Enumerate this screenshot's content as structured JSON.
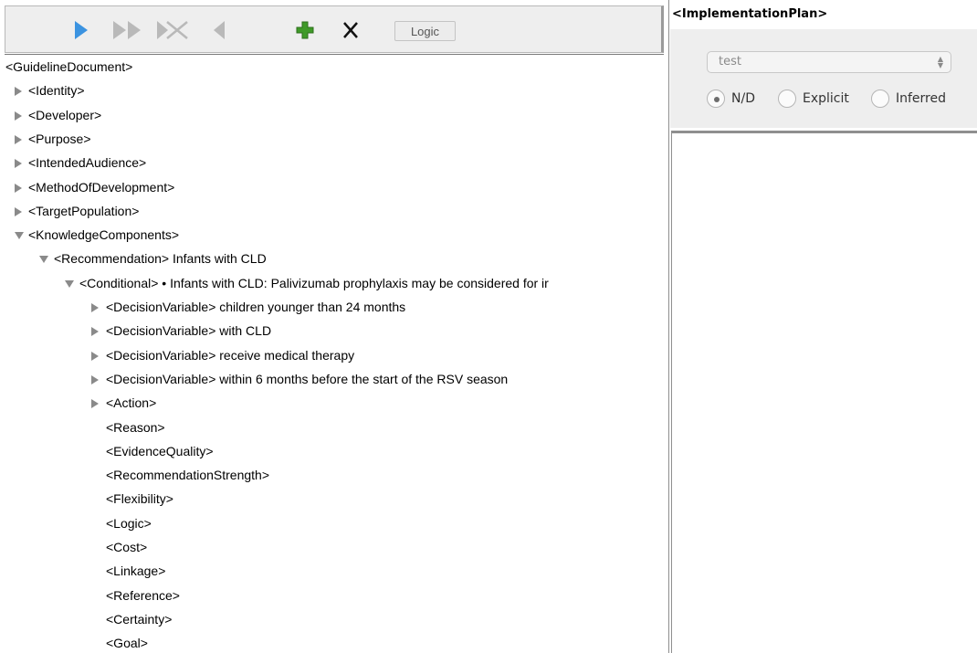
{
  "toolbar": {
    "buttons": [
      {
        "name": "play-icon",
        "color": "#3b93e0"
      },
      {
        "name": "fast-forward-icon",
        "color": "#b9b9b9"
      },
      {
        "name": "skip-clear-icon",
        "color": "#b9b9b9"
      },
      {
        "name": "back-icon",
        "color": "#b9b9b9"
      },
      {
        "name": "add-icon",
        "color": "#3f9a28"
      },
      {
        "name": "delete-icon",
        "color": "#111111"
      }
    ],
    "logic_label": "Logic"
  },
  "tree": [
    {
      "text": "<GuidelineDocument>",
      "depth": 0,
      "arrow": "none"
    },
    {
      "text": "<Identity>",
      "depth": 1,
      "arrow": "collapsed"
    },
    {
      "text": "<Developer>",
      "depth": 1,
      "arrow": "collapsed"
    },
    {
      "text": "<Purpose>",
      "depth": 1,
      "arrow": "collapsed"
    },
    {
      "text": "<IntendedAudience>",
      "depth": 1,
      "arrow": "collapsed"
    },
    {
      "text": "<MethodOfDevelopment>",
      "depth": 1,
      "arrow": "collapsed"
    },
    {
      "text": "<TargetPopulation>",
      "depth": 1,
      "arrow": "collapsed"
    },
    {
      "text": "<KnowledgeComponents>",
      "depth": 1,
      "arrow": "expanded"
    },
    {
      "text": "<Recommendation> Infants with CLD",
      "depth": 2,
      "arrow": "expanded"
    },
    {
      "text": "<Conditional> • Infants with CLD: Palivizumab prophylaxis may be considered for ir",
      "depth": 3,
      "arrow": "expanded"
    },
    {
      "text": "<DecisionVariable> children younger than 24 months",
      "depth": 4,
      "arrow": "collapsed"
    },
    {
      "text": "<DecisionVariable> with CLD",
      "depth": 4,
      "arrow": "collapsed"
    },
    {
      "text": "<DecisionVariable> receive medical therapy",
      "depth": 4,
      "arrow": "collapsed"
    },
    {
      "text": "<DecisionVariable> within 6 months before the start of the RSV season",
      "depth": 4,
      "arrow": "collapsed"
    },
    {
      "text": "<Action>",
      "depth": 4,
      "arrow": "collapsed"
    },
    {
      "text": "<Reason>",
      "depth": 4,
      "arrow": "none"
    },
    {
      "text": "<EvidenceQuality>",
      "depth": 4,
      "arrow": "none"
    },
    {
      "text": "<RecommendationStrength>",
      "depth": 4,
      "arrow": "none"
    },
    {
      "text": "<Flexibility>",
      "depth": 4,
      "arrow": "none"
    },
    {
      "text": "<Logic>",
      "depth": 4,
      "arrow": "none"
    },
    {
      "text": "<Cost>",
      "depth": 4,
      "arrow": "none"
    },
    {
      "text": "<Linkage>",
      "depth": 4,
      "arrow": "none"
    },
    {
      "text": "<Reference>",
      "depth": 4,
      "arrow": "none"
    },
    {
      "text": "<Certainty>",
      "depth": 4,
      "arrow": "none"
    },
    {
      "text": "<Goal>",
      "depth": 4,
      "arrow": "none"
    }
  ],
  "implementation": {
    "title": "<ImplementationPlan>",
    "combo_value": "test",
    "radios": [
      {
        "label": "N/D",
        "checked": true
      },
      {
        "label": "Explicit",
        "checked": false
      },
      {
        "label": "Inferred",
        "checked": false
      }
    ]
  }
}
